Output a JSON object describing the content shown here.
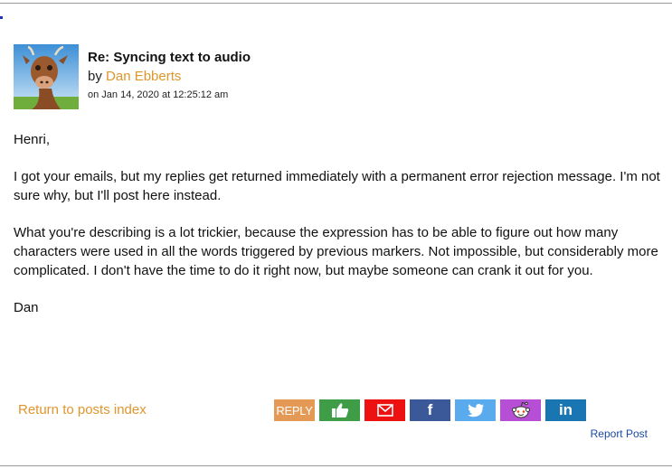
{
  "post": {
    "title": "Re: Syncing text to audio",
    "by_prefix": "by",
    "author": "Dan Ebberts",
    "date": "on Jan 14, 2020 at 12:25:12 am",
    "avatar_icon": "cow-avatar-photo"
  },
  "body": {
    "paragraphs": [
      "Henri,",
      "I got your emails, but my replies get returned immediately with a permanent error rejection message. I'm not sure why, but I'll post here instead.",
      "What you're describing is a lot trickier, because the expression has to be able to figure out how many characters were used in all the words triggered by previous markers. Not impossible, but considerably more complicated. I don't have the time to do it right now, but maybe someone can crank it out for you.",
      "Dan"
    ]
  },
  "footer": {
    "return_link": "Return to posts index",
    "report_link": "Report Post"
  },
  "actions": [
    {
      "name": "reply-button",
      "label": "REPLY",
      "icon": "reply",
      "color": "#e49a55"
    },
    {
      "name": "like-button",
      "label": "",
      "icon": "thumbs-up-icon",
      "color": "#3f9d47"
    },
    {
      "name": "email-share-button",
      "label": "",
      "icon": "envelope-icon",
      "color": "#ee1111"
    },
    {
      "name": "facebook-share-button",
      "label": "",
      "icon": "facebook-icon",
      "color": "#3b5998"
    },
    {
      "name": "twitter-share-button",
      "label": "",
      "icon": "twitter-icon",
      "color": "#5aabed"
    },
    {
      "name": "reddit-share-button",
      "label": "",
      "icon": "reddit-icon",
      "color": "#b64fd6"
    },
    {
      "name": "linkedin-share-button",
      "label": "",
      "icon": "linkedin-icon",
      "color": "#1a75b3"
    }
  ],
  "colors": {
    "accent_link": "#e0962c",
    "report_link": "#1a4aa6"
  }
}
